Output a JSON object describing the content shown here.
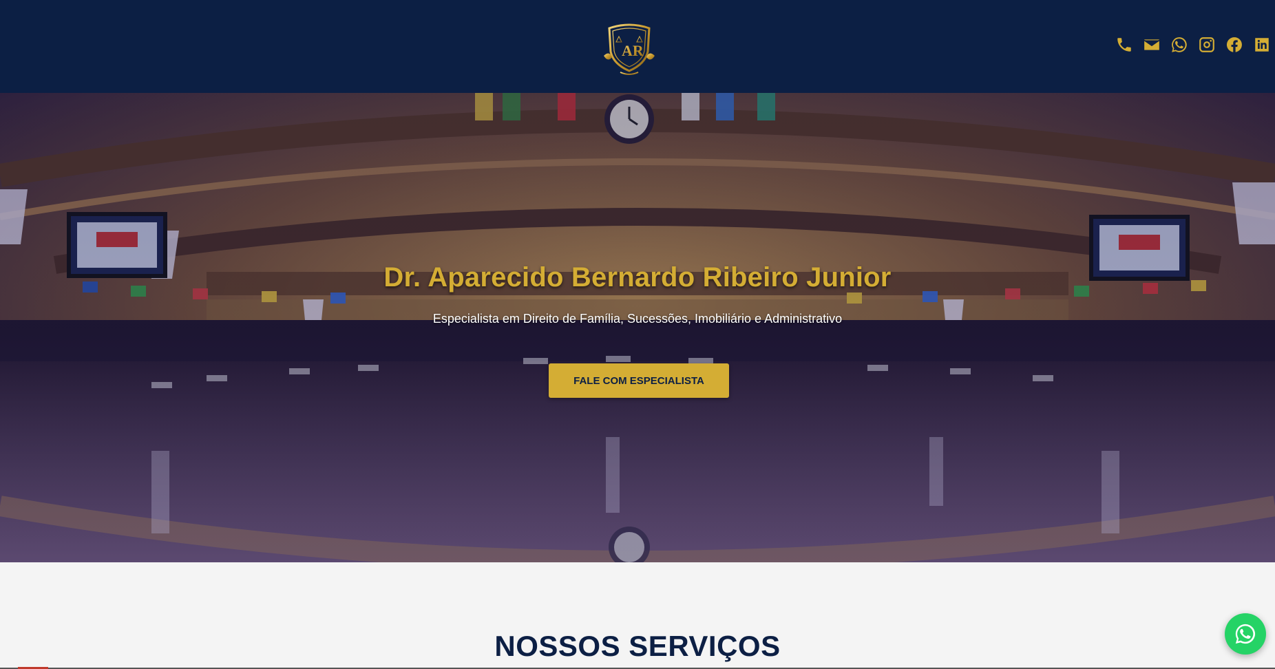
{
  "header": {
    "logo_text": "AR",
    "social_icons": [
      "phone-icon",
      "email-icon",
      "whatsapp-icon",
      "instagram-icon",
      "facebook-icon",
      "linkedin-icon"
    ],
    "icon_color": "#d4ad34",
    "background": "#0c1f44"
  },
  "hero": {
    "title": "Dr. Aparecido Bernardo Ribeiro Junior",
    "subtitle": "Especialista em Direito de Família, Sucessões, Imobiliário e Administrativo",
    "cta_label": "FALE COM ESPECIALISTA"
  },
  "services": {
    "title": "NOSSOS SERVIÇOS"
  },
  "floating": {
    "whatsapp_icon": "whatsapp-icon",
    "color": "#25d366"
  }
}
